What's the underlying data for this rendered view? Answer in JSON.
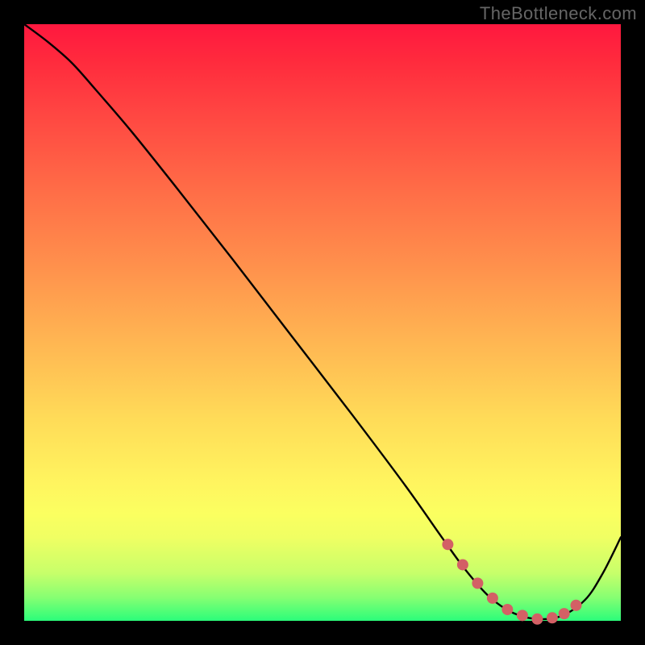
{
  "watermark": "TheBottleneck.com",
  "colors": {
    "background": "#000000",
    "curve": "#000000",
    "marker": "#d36065",
    "gradient_top": "#ff183f",
    "gradient_bottom": "#2bfd7a"
  },
  "chart_data": {
    "type": "line",
    "title": "",
    "xlabel": "",
    "ylabel": "",
    "xlim": [
      0,
      100
    ],
    "ylim": [
      0,
      100
    ],
    "series": [
      {
        "name": "bottleneck-curve",
        "x": [
          0,
          4,
          8,
          12,
          18,
          26,
          35,
          45,
          55,
          64,
          70,
          74,
          78,
          82,
          86,
          90,
          94,
          97,
          100
        ],
        "y": [
          100,
          97,
          93.5,
          89,
          82,
          72,
          60.5,
          47.5,
          34.5,
          22.5,
          14,
          8.5,
          4,
          1.3,
          0.3,
          0.8,
          3.5,
          8,
          14
        ]
      }
    ],
    "markers": {
      "name": "optimal-range",
      "x": [
        71,
        73.5,
        76,
        78.5,
        81,
        83.5,
        86,
        88.5,
        90.5,
        92.5
      ],
      "y": [
        12.8,
        9.4,
        6.3,
        3.8,
        1.9,
        0.9,
        0.3,
        0.5,
        1.2,
        2.6
      ]
    },
    "annotations": []
  }
}
